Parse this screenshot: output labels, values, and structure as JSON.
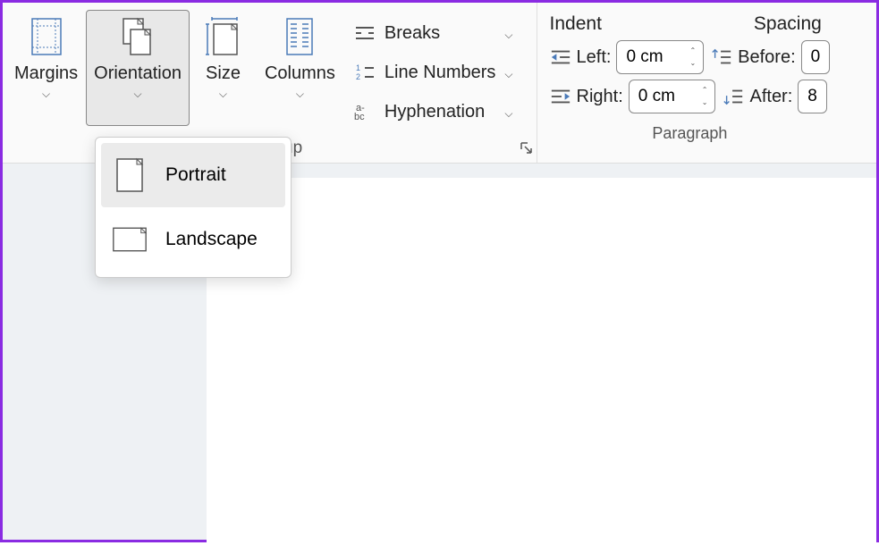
{
  "ribbon": {
    "pageSetup": {
      "margins": "Margins",
      "orientation": "Orientation",
      "size": "Size",
      "columns": "Columns",
      "breaks": "Breaks",
      "lineNumbers": "Line Numbers",
      "hyphenation": "Hyphenation",
      "groupLabel": "up"
    },
    "paragraph": {
      "indentHeader": "Indent",
      "spacingHeader": "Spacing",
      "leftLabel": "Left:",
      "rightLabel": "Right:",
      "beforeLabel": "Before:",
      "afterLabel": "After:",
      "leftValue": "0 cm",
      "rightValue": "0 cm",
      "beforeValue": "0",
      "afterValue": "8",
      "groupLabel": "Paragraph"
    }
  },
  "orientationDropdown": {
    "portrait": "Portrait",
    "landscape": "Landscape"
  }
}
